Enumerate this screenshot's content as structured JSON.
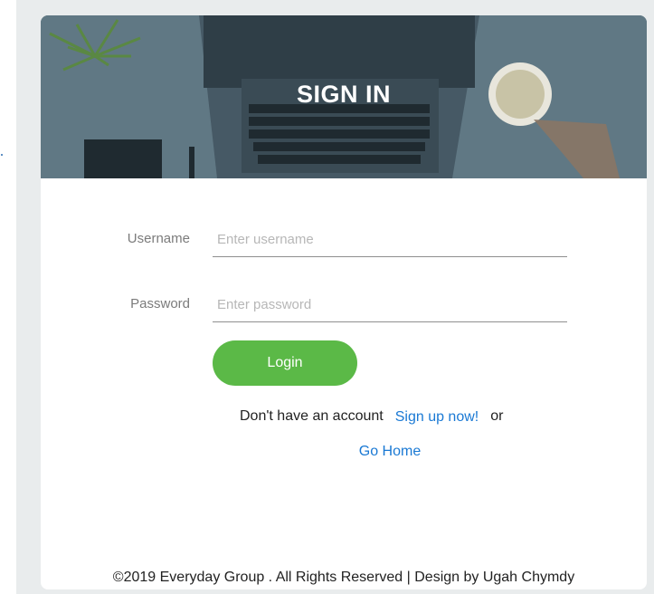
{
  "header": {
    "title": "SIGN IN"
  },
  "form": {
    "username": {
      "label": "Username",
      "placeholder": "Enter username",
      "value": ""
    },
    "password": {
      "label": "Password",
      "placeholder": "Enter password",
      "value": ""
    },
    "login_label": "Login"
  },
  "links": {
    "no_account_text": "Don't have an account",
    "signup_label": "Sign up now!",
    "or_text": "or",
    "home_label": "Go Home"
  },
  "footer": {
    "text": "©2019 Everyday Group . All Rights Reserved | Design by Ugah Chymdy"
  },
  "colors": {
    "accent": "#5bb947",
    "link": "#1a79d4",
    "hero_overlay": "#5f7682",
    "page_bg": "#e9eced"
  }
}
